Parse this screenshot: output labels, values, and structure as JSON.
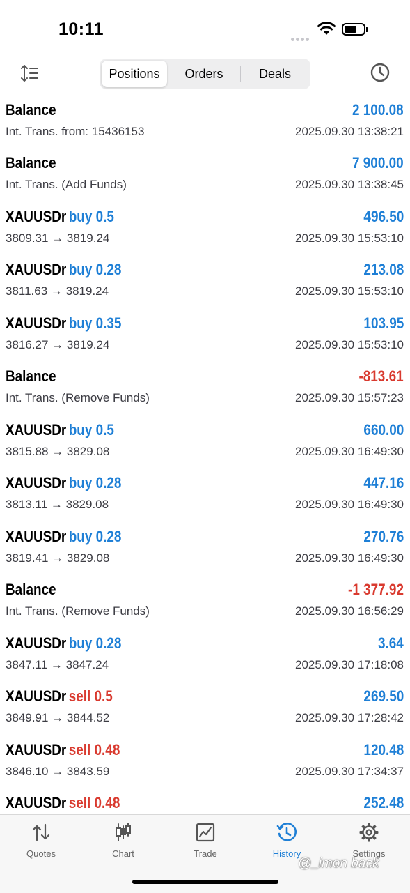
{
  "status": {
    "time": "10:11"
  },
  "toolbar": {
    "tabs": [
      {
        "label": "Positions",
        "active": true
      },
      {
        "label": "Orders",
        "active": false
      },
      {
        "label": "Deals",
        "active": false
      }
    ]
  },
  "colors": {
    "accent": "#1e7fd6",
    "loss": "#d93a2f"
  },
  "rows": [
    {
      "symbol": "Balance",
      "dir": "",
      "sub": "Int. Trans. from: 15436153",
      "profit": "2 100.08",
      "date": "2025.09.30 13:38:21"
    },
    {
      "symbol": "Balance",
      "dir": "",
      "sub": "Int. Trans. (Add Funds)",
      "profit": "7 900.00",
      "date": "2025.09.30 13:38:45"
    },
    {
      "symbol": "XAUUSDr",
      "dir": "buy 0.5",
      "sub": "3809.31 → 3819.24",
      "profit": "496.50",
      "date": "2025.09.30 15:53:10"
    },
    {
      "symbol": "XAUUSDr",
      "dir": "buy 0.28",
      "sub": "3811.63 → 3819.24",
      "profit": "213.08",
      "date": "2025.09.30 15:53:10"
    },
    {
      "symbol": "XAUUSDr",
      "dir": "buy 0.35",
      "sub": "3816.27 → 3819.24",
      "profit": "103.95",
      "date": "2025.09.30 15:53:10"
    },
    {
      "symbol": "Balance",
      "dir": "",
      "sub": "Int. Trans. (Remove Funds)",
      "profit": "-813.61",
      "date": "2025.09.30 15:57:23"
    },
    {
      "symbol": "XAUUSDr",
      "dir": "buy 0.5",
      "sub": "3815.88 → 3829.08",
      "profit": "660.00",
      "date": "2025.09.30 16:49:30"
    },
    {
      "symbol": "XAUUSDr",
      "dir": "buy 0.28",
      "sub": "3813.11 → 3829.08",
      "profit": "447.16",
      "date": "2025.09.30 16:49:30"
    },
    {
      "symbol": "XAUUSDr",
      "dir": "buy 0.28",
      "sub": "3819.41 → 3829.08",
      "profit": "270.76",
      "date": "2025.09.30 16:49:30"
    },
    {
      "symbol": "Balance",
      "dir": "",
      "sub": "Int. Trans. (Remove Funds)",
      "profit": "-1 377.92",
      "date": "2025.09.30 16:56:29"
    },
    {
      "symbol": "XAUUSDr",
      "dir": "buy 0.28",
      "sub": "3847.11 → 3847.24",
      "profit": "3.64",
      "date": "2025.09.30 17:18:08"
    },
    {
      "symbol": "XAUUSDr",
      "dir": "sell 0.5",
      "sub": "3849.91 → 3844.52",
      "profit": "269.50",
      "date": "2025.09.30 17:28:42"
    },
    {
      "symbol": "XAUUSDr",
      "dir": "sell 0.48",
      "sub": "3846.10 → 3843.59",
      "profit": "120.48",
      "date": "2025.09.30 17:34:37"
    },
    {
      "symbol": "XAUUSDr",
      "dir": "sell 0.48",
      "sub": "",
      "profit": "252.48",
      "date": ""
    }
  ],
  "tabbar": [
    {
      "label": "Quotes",
      "icon": "quotes-icon",
      "active": false
    },
    {
      "label": "Chart",
      "icon": "candlestick-chart-icon",
      "active": false
    },
    {
      "label": "Trade",
      "icon": "trade-chart-icon",
      "active": false
    },
    {
      "label": "History",
      "icon": "history-icon",
      "active": true
    },
    {
      "label": "Settings",
      "icon": "gear-icon",
      "active": false
    }
  ],
  "watermark": "@_imon back"
}
